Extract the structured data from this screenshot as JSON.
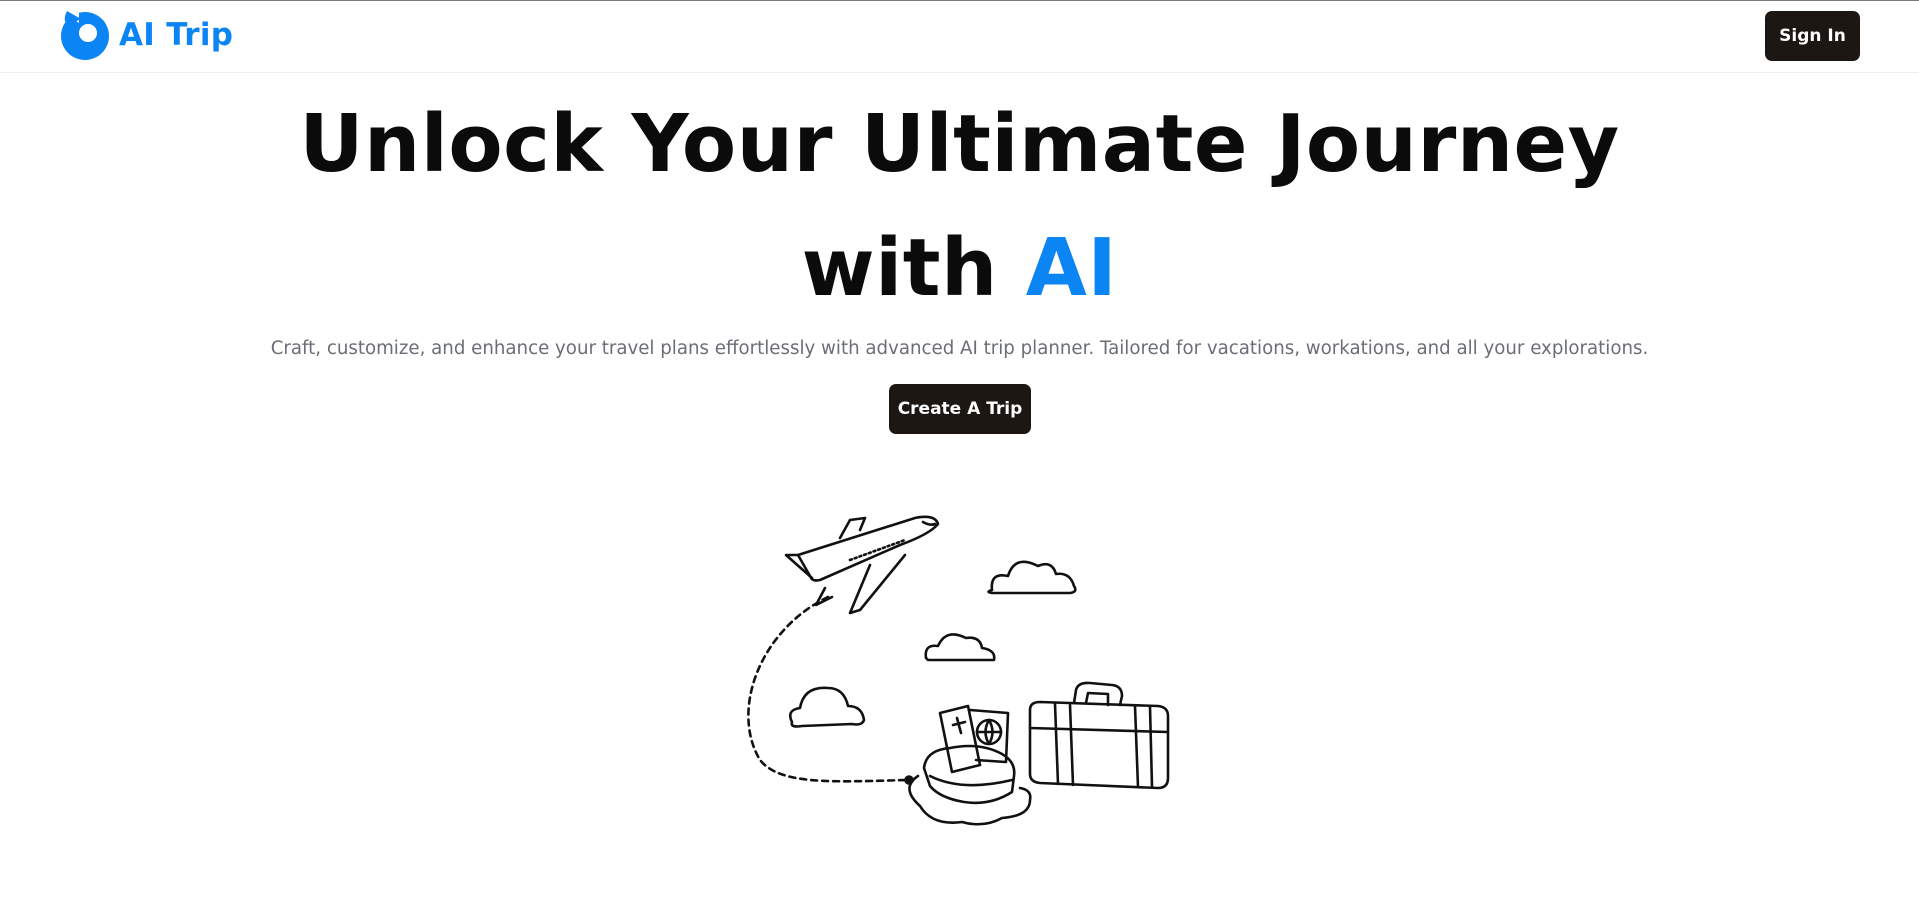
{
  "brand": {
    "name": "AI Trip",
    "color": "#0b84f4",
    "icon": "logo-icon"
  },
  "header": {
    "sign_in_label": "Sign In"
  },
  "hero": {
    "headline_line1": "Unlock Your Ultimate Journey",
    "headline_with": "with",
    "headline_accent": "AI",
    "subtitle": "Craft, customize, and enhance your travel plans effortlessly with advanced AI trip planner. Tailored for vacations, workations, and all your explorations.",
    "cta_label": "Create A Trip"
  },
  "illustration": {
    "icon": "travel-illustration"
  },
  "colors": {
    "button_bg": "#1c1713",
    "accent": "#0b84f4",
    "subtitle": "#6b6e76"
  }
}
